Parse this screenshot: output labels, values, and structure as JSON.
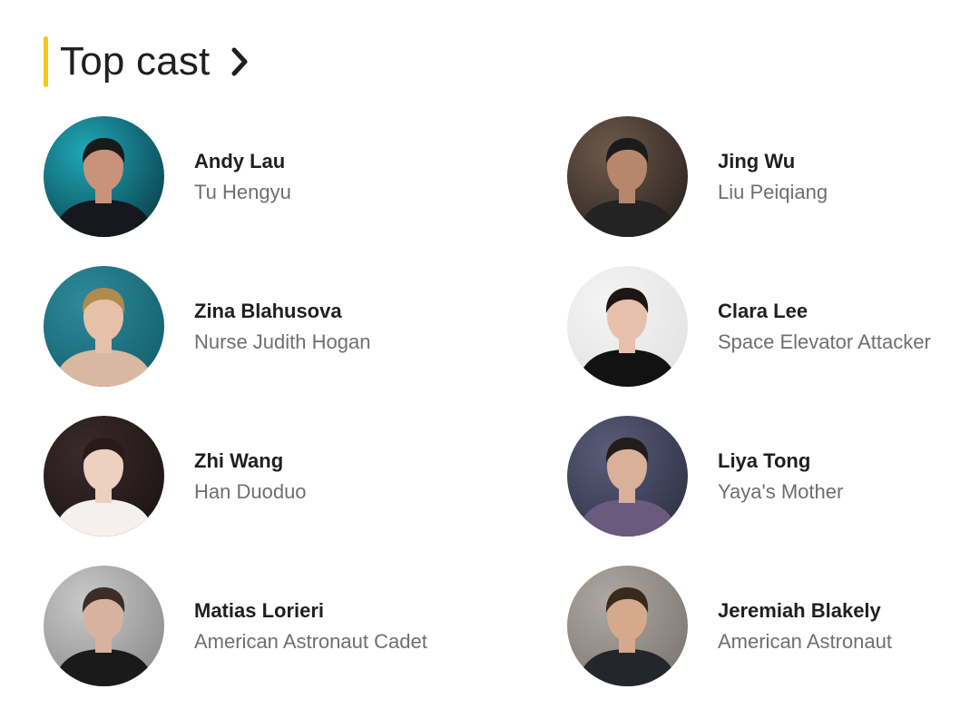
{
  "header": {
    "title": "Top cast",
    "accent_color": "#f5c518",
    "chevron_icon": "chevron-right-icon"
  },
  "cast": [
    {
      "actor": "Andy Lau",
      "character": "Tu Hengyu",
      "avatar": {
        "bg": "#1fa8b8",
        "bg2": "#0b3c48",
        "skin": "#c8937a",
        "hair": "#1a1a1a",
        "cloth": "#15181c"
      }
    },
    {
      "actor": "Jing Wu",
      "character": "Liu Peiqiang",
      "avatar": {
        "bg": "#6e5a4c",
        "bg2": "#2a211c",
        "skin": "#b6876c",
        "hair": "#1b1b1b",
        "cloth": "#232323"
      }
    },
    {
      "actor": "Zina Blahusova",
      "character": "Nurse Judith Hogan",
      "avatar": {
        "bg": "#2e8a9a",
        "bg2": "#135e6c",
        "skin": "#e6c0a8",
        "hair": "#b08a4e",
        "cloth": "#d9b8a2"
      }
    },
    {
      "actor": "Clara Lee",
      "character": "Space Elevator Attacker",
      "avatar": {
        "bg": "#f4f4f4",
        "bg2": "#e2e2e2",
        "skin": "#e7c0ac",
        "hair": "#1e1614",
        "cloth": "#121212"
      }
    },
    {
      "actor": "Zhi Wang",
      "character": "Han Duoduo",
      "avatar": {
        "bg": "#3a2a2c",
        "bg2": "#1c1314",
        "skin": "#ecd0c0",
        "hair": "#2a1a18",
        "cloth": "#f5f0ee"
      }
    },
    {
      "actor": "Liya Tong",
      "character": "Yaya's Mother",
      "avatar": {
        "bg": "#5a5d78",
        "bg2": "#2e3046",
        "skin": "#d9b09a",
        "hair": "#241c1c",
        "cloth": "#6a5a7e"
      }
    },
    {
      "actor": "Matias Lorieri",
      "character": "American Astronaut Cadet",
      "avatar": {
        "bg": "#c9c9c9",
        "bg2": "#8a8a8a",
        "skin": "#d5b3a0",
        "hair": "#3a2e26",
        "cloth": "#1a1a1a"
      }
    },
    {
      "actor": "Jeremiah Blakely",
      "character": "American Astronaut",
      "avatar": {
        "bg": "#b0a8a2",
        "bg2": "#7c746e",
        "skin": "#d6a88c",
        "hair": "#3a2a1e",
        "cloth": "#23262c"
      }
    }
  ]
}
